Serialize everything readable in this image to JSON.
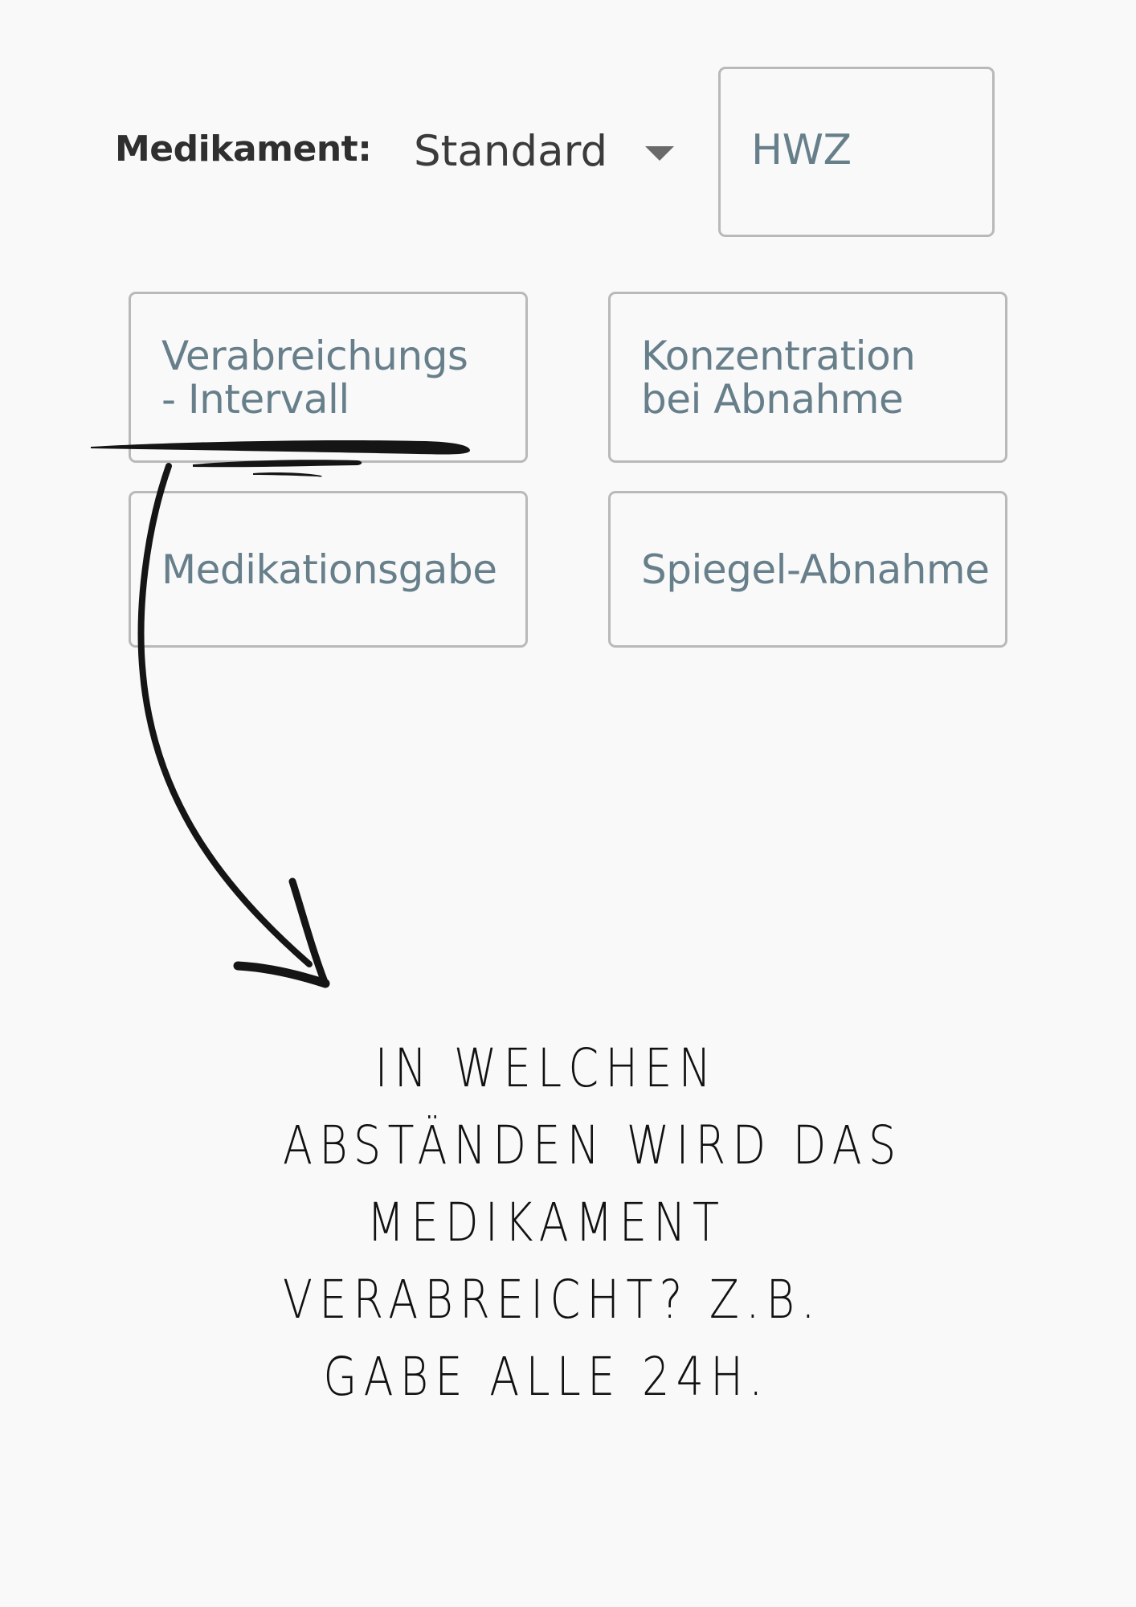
{
  "form": {
    "medication_label": "Medikament:",
    "medication_select": {
      "selected": "Standard"
    },
    "fields": {
      "hwz": [
        "HWZ"
      ],
      "interval": [
        "Verabreichungs",
        "- Intervall"
      ],
      "concentration": [
        "Konzentration",
        "bei Abnahme"
      ],
      "medication_dose": [
        "Medikationsgabe"
      ],
      "level_sampling": [
        "Spiegel-Abnahme"
      ]
    }
  },
  "annotation": {
    "lines": [
      "IN WELCHEN",
      "ABSTÄNDEN WIRD DAS",
      "MEDIKAMENT",
      "VERABREICHT? Z.B.",
      "GABE ALLE 24H."
    ],
    "ink_color": "#151515",
    "icons": [
      "hand-drawn-underline",
      "hand-drawn-arrow"
    ]
  },
  "colors": {
    "background": "#f9f9f9",
    "field_border": "#b9b9b9",
    "field_text": "#677f8a",
    "label_text": "#2f2f2f"
  }
}
